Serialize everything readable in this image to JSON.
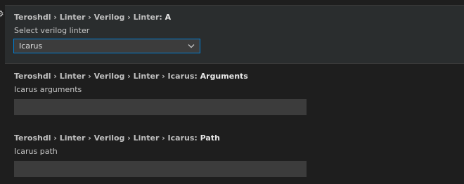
{
  "settings": [
    {
      "category": "Teroshdl › Linter › Verilog › Linter: ",
      "key": "A",
      "description": "Select verilog linter",
      "control": "select",
      "value": "Icarus"
    },
    {
      "category": "Teroshdl › Linter › Verilog › Linter › Icarus: ",
      "key": "Arguments",
      "description": "Icarus arguments",
      "control": "text",
      "value": ""
    },
    {
      "category": "Teroshdl › Linter › Verilog › Linter › Icarus: ",
      "key": "Path",
      "description": "Icarus path",
      "control": "text",
      "value": ""
    }
  ],
  "icons": {
    "gear": "gear-icon",
    "dropdown": "chevron-down-icon"
  },
  "colors": {
    "background": "#1e1e1e",
    "focused_row": "#2a2d2e",
    "input_bg": "#3c3c3c",
    "focus_border": "#007fd4"
  }
}
